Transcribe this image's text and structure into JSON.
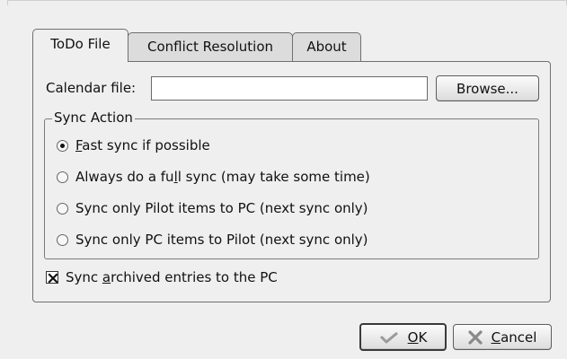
{
  "tabs": [
    {
      "label": "ToDo File",
      "active": true
    },
    {
      "label": "Conflict Resolution",
      "active": false
    },
    {
      "label": "About",
      "active": false
    }
  ],
  "calendar": {
    "label": "Calendar file:",
    "value": "",
    "browse_label": "Browse..."
  },
  "sync_action": {
    "title": "Sync Action",
    "options": [
      {
        "mnemonic": "F",
        "rest": "ast sync if possible",
        "checked": true
      },
      {
        "before": "Always do a fu",
        "mnemonic": "l",
        "after": "l sync (may take some time)",
        "checked": false
      },
      {
        "label": "Sync only Pilot items to PC (next sync only)",
        "checked": false
      },
      {
        "label": "Sync only PC items to Pilot (next sync only)",
        "checked": false
      }
    ]
  },
  "archived": {
    "before": "Sync ",
    "mnemonic": "a",
    "after": "rchived entries to the PC",
    "checked": true
  },
  "buttons": {
    "ok_mnemonic": "O",
    "ok_rest": "K",
    "cancel_mnemonic": "C",
    "cancel_rest": "ancel"
  },
  "icons": {
    "ok": "checkmark-icon",
    "cancel": "x-cross-icon"
  }
}
